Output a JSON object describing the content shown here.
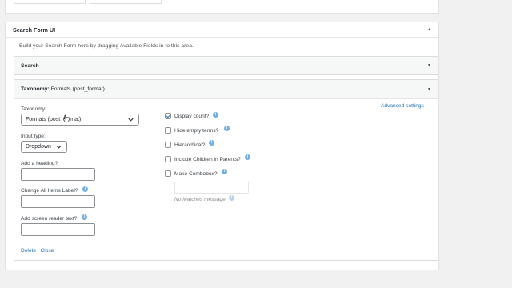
{
  "panel": {
    "title": "Search Form UI",
    "help_text": "Build your Search Form here by dragging Available Fields in to this area."
  },
  "search_item": {
    "title": "Search"
  },
  "taxonomy_item": {
    "title_bold": "Taxonomy:",
    "title_rest": "Formats (post_format)",
    "advanced_link": "Advanced settings",
    "taxonomy_label": "Taxonomy:",
    "taxonomy_value": "Formats (post_format)",
    "input_type_label": "Input type:",
    "input_type_value": "Dropdown",
    "heading_label": "Add a heading?",
    "heading_value": "",
    "change_all_label": "Change All Items Label?",
    "change_all_value": "",
    "screen_reader_label": "Add screen reader text?",
    "screen_reader_value": "",
    "options": [
      {
        "label": "Display count?",
        "checked": true
      },
      {
        "label": "Hide empty terms?",
        "checked": false
      },
      {
        "label": "Hierarchical?",
        "checked": false
      },
      {
        "label": "Include Children in Parents?",
        "checked": false
      },
      {
        "label": "Make Combobox?",
        "checked": false
      }
    ],
    "no_matches": "No Matches message",
    "delete_link": "Delete",
    "separator": "|",
    "close_link": "Close"
  },
  "icons": {
    "info": "info-icon",
    "caret": "caret-icon",
    "chevron": "chevron-down-icon"
  },
  "colors": {
    "link": "#2271b1",
    "info": "#72aee6",
    "background": "#f1f1f1"
  }
}
